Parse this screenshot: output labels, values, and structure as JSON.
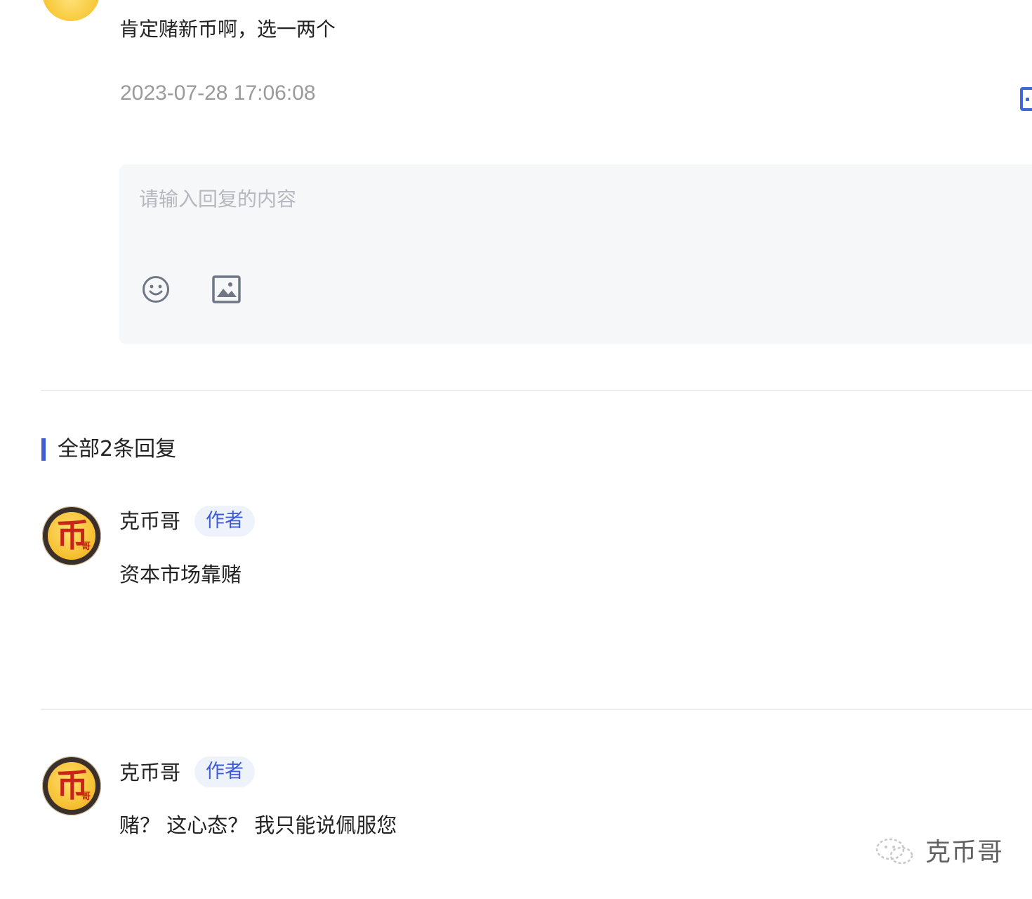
{
  "comment": {
    "text": "肯定赌新币啊，选一两个",
    "timestamp": "2023-07-28 17:06:08"
  },
  "reply_box": {
    "placeholder": "请输入回复的内容",
    "emoji_icon": "smiley-icon",
    "image_icon": "image-icon"
  },
  "replies_section": {
    "title": "全部2条回复"
  },
  "replies": [
    {
      "username": "克币哥",
      "badge": "作者",
      "content": "资本市场靠赌",
      "avatar_glyph": "币",
      "avatar_small": "哥"
    },
    {
      "username": "克币哥",
      "badge": "作者",
      "content": "赌？ 这心态？ 我只能说佩服您",
      "avatar_glyph": "币",
      "avatar_small": "哥"
    }
  ],
  "watermark": {
    "text": "克币哥"
  },
  "colors": {
    "accent": "#3e5bd8",
    "badge_bg": "#eef2fb",
    "muted_text": "#9a9a9a",
    "input_bg": "#f6f7f9"
  }
}
